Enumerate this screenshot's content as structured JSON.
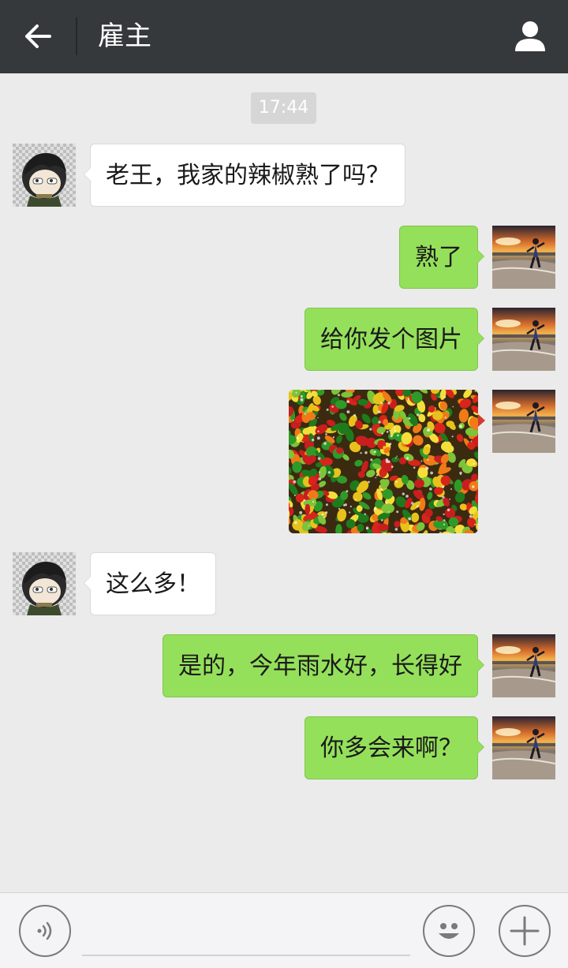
{
  "header": {
    "title": "雇主",
    "back_icon": "arrow-left-icon",
    "profile_icon": "person-icon"
  },
  "timestamp": "17:44",
  "messages": [
    {
      "side": "left",
      "type": "text",
      "text": "老王，我家的辣椒熟了吗？"
    },
    {
      "side": "right",
      "type": "text",
      "text": "熟了"
    },
    {
      "side": "right",
      "type": "text",
      "text": "给你发个图片"
    },
    {
      "side": "right",
      "type": "image",
      "image": "chili-peppers-photo"
    },
    {
      "side": "left",
      "type": "text",
      "text": "这么多！"
    },
    {
      "side": "right",
      "type": "text",
      "text": "是的，今年雨水好，长得好"
    },
    {
      "side": "right",
      "type": "text",
      "text": "你多会来啊？"
    }
  ],
  "input_bar": {
    "voice_icon": "voice-icon",
    "emoji_icon": "emoji-icon",
    "plus_icon": "plus-icon",
    "input_value": ""
  },
  "colors": {
    "header_bg": "#35393c",
    "chat_bg": "#ebebeb",
    "outgoing_bubble": "#95e05b",
    "incoming_bubble": "#ffffff",
    "timestamp_bg": "#d6d6d6"
  }
}
